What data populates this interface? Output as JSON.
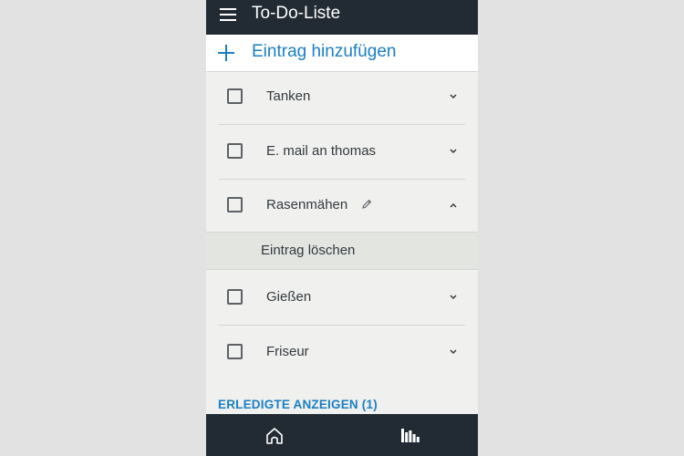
{
  "header": {
    "title": "To-Do-Liste",
    "menu_icon": "hamburger-menu-icon"
  },
  "add_entry": {
    "label": "Eintrag hinzufügen",
    "icon": "plus-icon"
  },
  "items": [
    {
      "label": "Tanken",
      "checked": false,
      "expanded": false
    },
    {
      "label": "E. mail an thomas",
      "checked": false,
      "expanded": false
    },
    {
      "label": "Rasenmähen",
      "checked": false,
      "expanded": true,
      "editable_icon": "pencil-icon"
    },
    {
      "label": "Gießen",
      "checked": false,
      "expanded": false
    },
    {
      "label": "Friseur",
      "checked": false,
      "expanded": false
    }
  ],
  "expanded_actions": {
    "delete_label": "Eintrag löschen"
  },
  "show_completed": {
    "label": "ERLEDIGTE ANZEIGEN (1)"
  },
  "bottom_nav": [
    {
      "icon": "home-icon"
    },
    {
      "icon": "now-playing-icon"
    }
  ],
  "colors": {
    "header_bg": "#222b33",
    "accent": "#1a7fc2",
    "list_bg": "#f0f0ee",
    "page_bg": "#e3e2e2"
  }
}
